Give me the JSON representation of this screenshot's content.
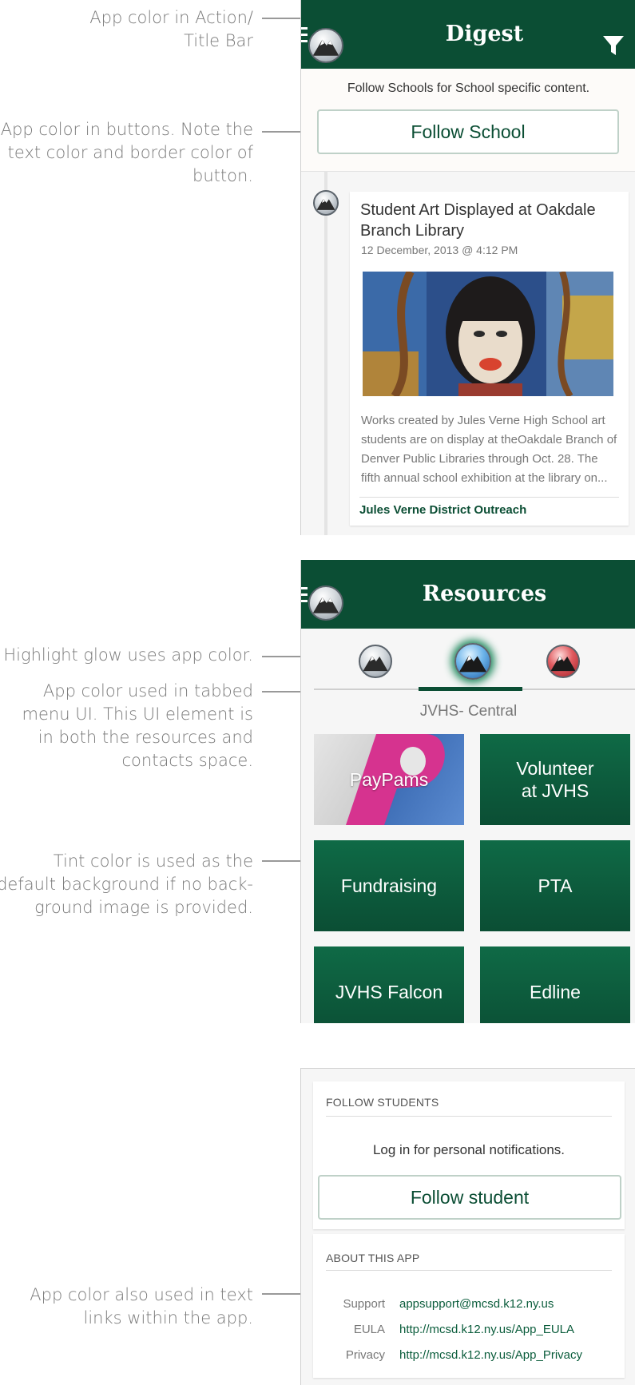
{
  "annotations": {
    "action_bar": [
      "App color in Action/",
      "Title Bar"
    ],
    "buttons": [
      "App color in buttons. Note the",
      "text color and border color of",
      "button."
    ],
    "glow": [
      "Highlight glow uses app color."
    ],
    "tabs": [
      "App color used in tabbed",
      "menu UI. This UI element is",
      "in both the resources and",
      "contacts space."
    ],
    "tint": [
      "Tint color is used as the",
      "default background if no back-",
      "ground image is provided."
    ],
    "links": [
      "App color also used in text",
      "links within the app."
    ]
  },
  "digest": {
    "title": "Digest",
    "follow_prompt": "Follow Schools for School specific content.",
    "follow_button": "Follow School",
    "post": {
      "title": "Student Art Displayed at Oakdale Branch Library",
      "date": "12 December, 2013 @ 4:12 PM",
      "excerpt": "Works created by Jules Verne High School art students are on display at theOakdale  Branch of Denver Public Libraries through Oct. 28. The fifth annual school exhibition at the library on...",
      "source": "Jules Verne District Outreach"
    }
  },
  "resources": {
    "title": "Resources",
    "active_tab_label": "JVHS- Central",
    "tiles": [
      "PayPams",
      "Volunteer at JVHS",
      "Fundraising",
      "PTA",
      "JVHS Falcon",
      "Edline"
    ]
  },
  "settings": {
    "follow_students_header": "FOLLOW STUDENTS",
    "login_prompt": "Log in for personal notifications.",
    "follow_student_button": "Follow student",
    "about_header": "ABOUT THIS APP",
    "links": [
      {
        "label": "Support",
        "value": "appsupport@mcsd.k12.ny.us"
      },
      {
        "label": "EULA",
        "value": "http://mcsd.k12.ny.us/App_EULA"
      },
      {
        "label": "Privacy",
        "value": "http://mcsd.k12.ny.us/App_Privacy"
      }
    ]
  },
  "colors": {
    "app_color": "#0b4e34",
    "link_color": "#0b5d3c",
    "glow_color": "#1f8a5e",
    "tab_inactive_red": "#c8323c",
    "paypams_pink": "#d6338f"
  }
}
